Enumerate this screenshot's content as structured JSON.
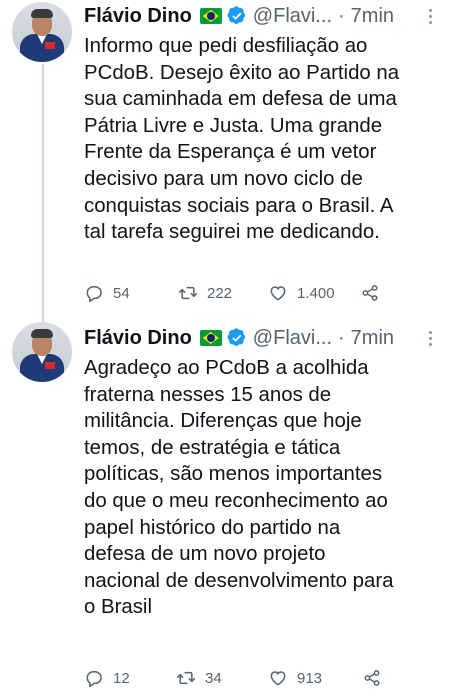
{
  "tweets": [
    {
      "author_name": "Flávio Dino",
      "handle": "@Flavi...",
      "separator": "·",
      "time": "7min",
      "text": "Informo que pedi desfiliação ao\nPCdoB. Desejo êxito ao Partido na\nsua caminhada em defesa de uma\nPátria Livre e Justa. Uma grande\nFrente da Esperança é um vetor\ndecisivo para um novo ciclo de\nconquistas sociais para o Brasil. A\ntal tarefa seguirei me dedicando.",
      "replies": "54",
      "retweets": "222",
      "likes": "1.400"
    },
    {
      "author_name": "Flávio Dino",
      "handle": "@Flavi...",
      "separator": "·",
      "time": "7min",
      "text": "Agradeço ao PCdoB a acolhida\nfraterna nesses 15 anos de\nmilitância. Diferenças que hoje\ntemos, de estratégia e tática\npolíticas, são menos importantes\ndo que o meu reconhecimento ao\npapel histórico do partido na\ndefesa de um novo projeto\nnacional de desenvolvimento para\no Brasil",
      "replies": "12",
      "retweets": "34",
      "likes": "913"
    }
  ],
  "icons": {
    "reply": "reply-icon",
    "retweet": "retweet-icon",
    "like": "heart-icon",
    "share": "share-icon",
    "verified": "verified-badge-icon",
    "more": "more-options-icon",
    "flag": "brazil-flag-emoji"
  },
  "colors": {
    "text": "#0f1419",
    "secondary": "#536471",
    "verified": "#1d9bf0",
    "thread_line": "#cfd9de"
  }
}
